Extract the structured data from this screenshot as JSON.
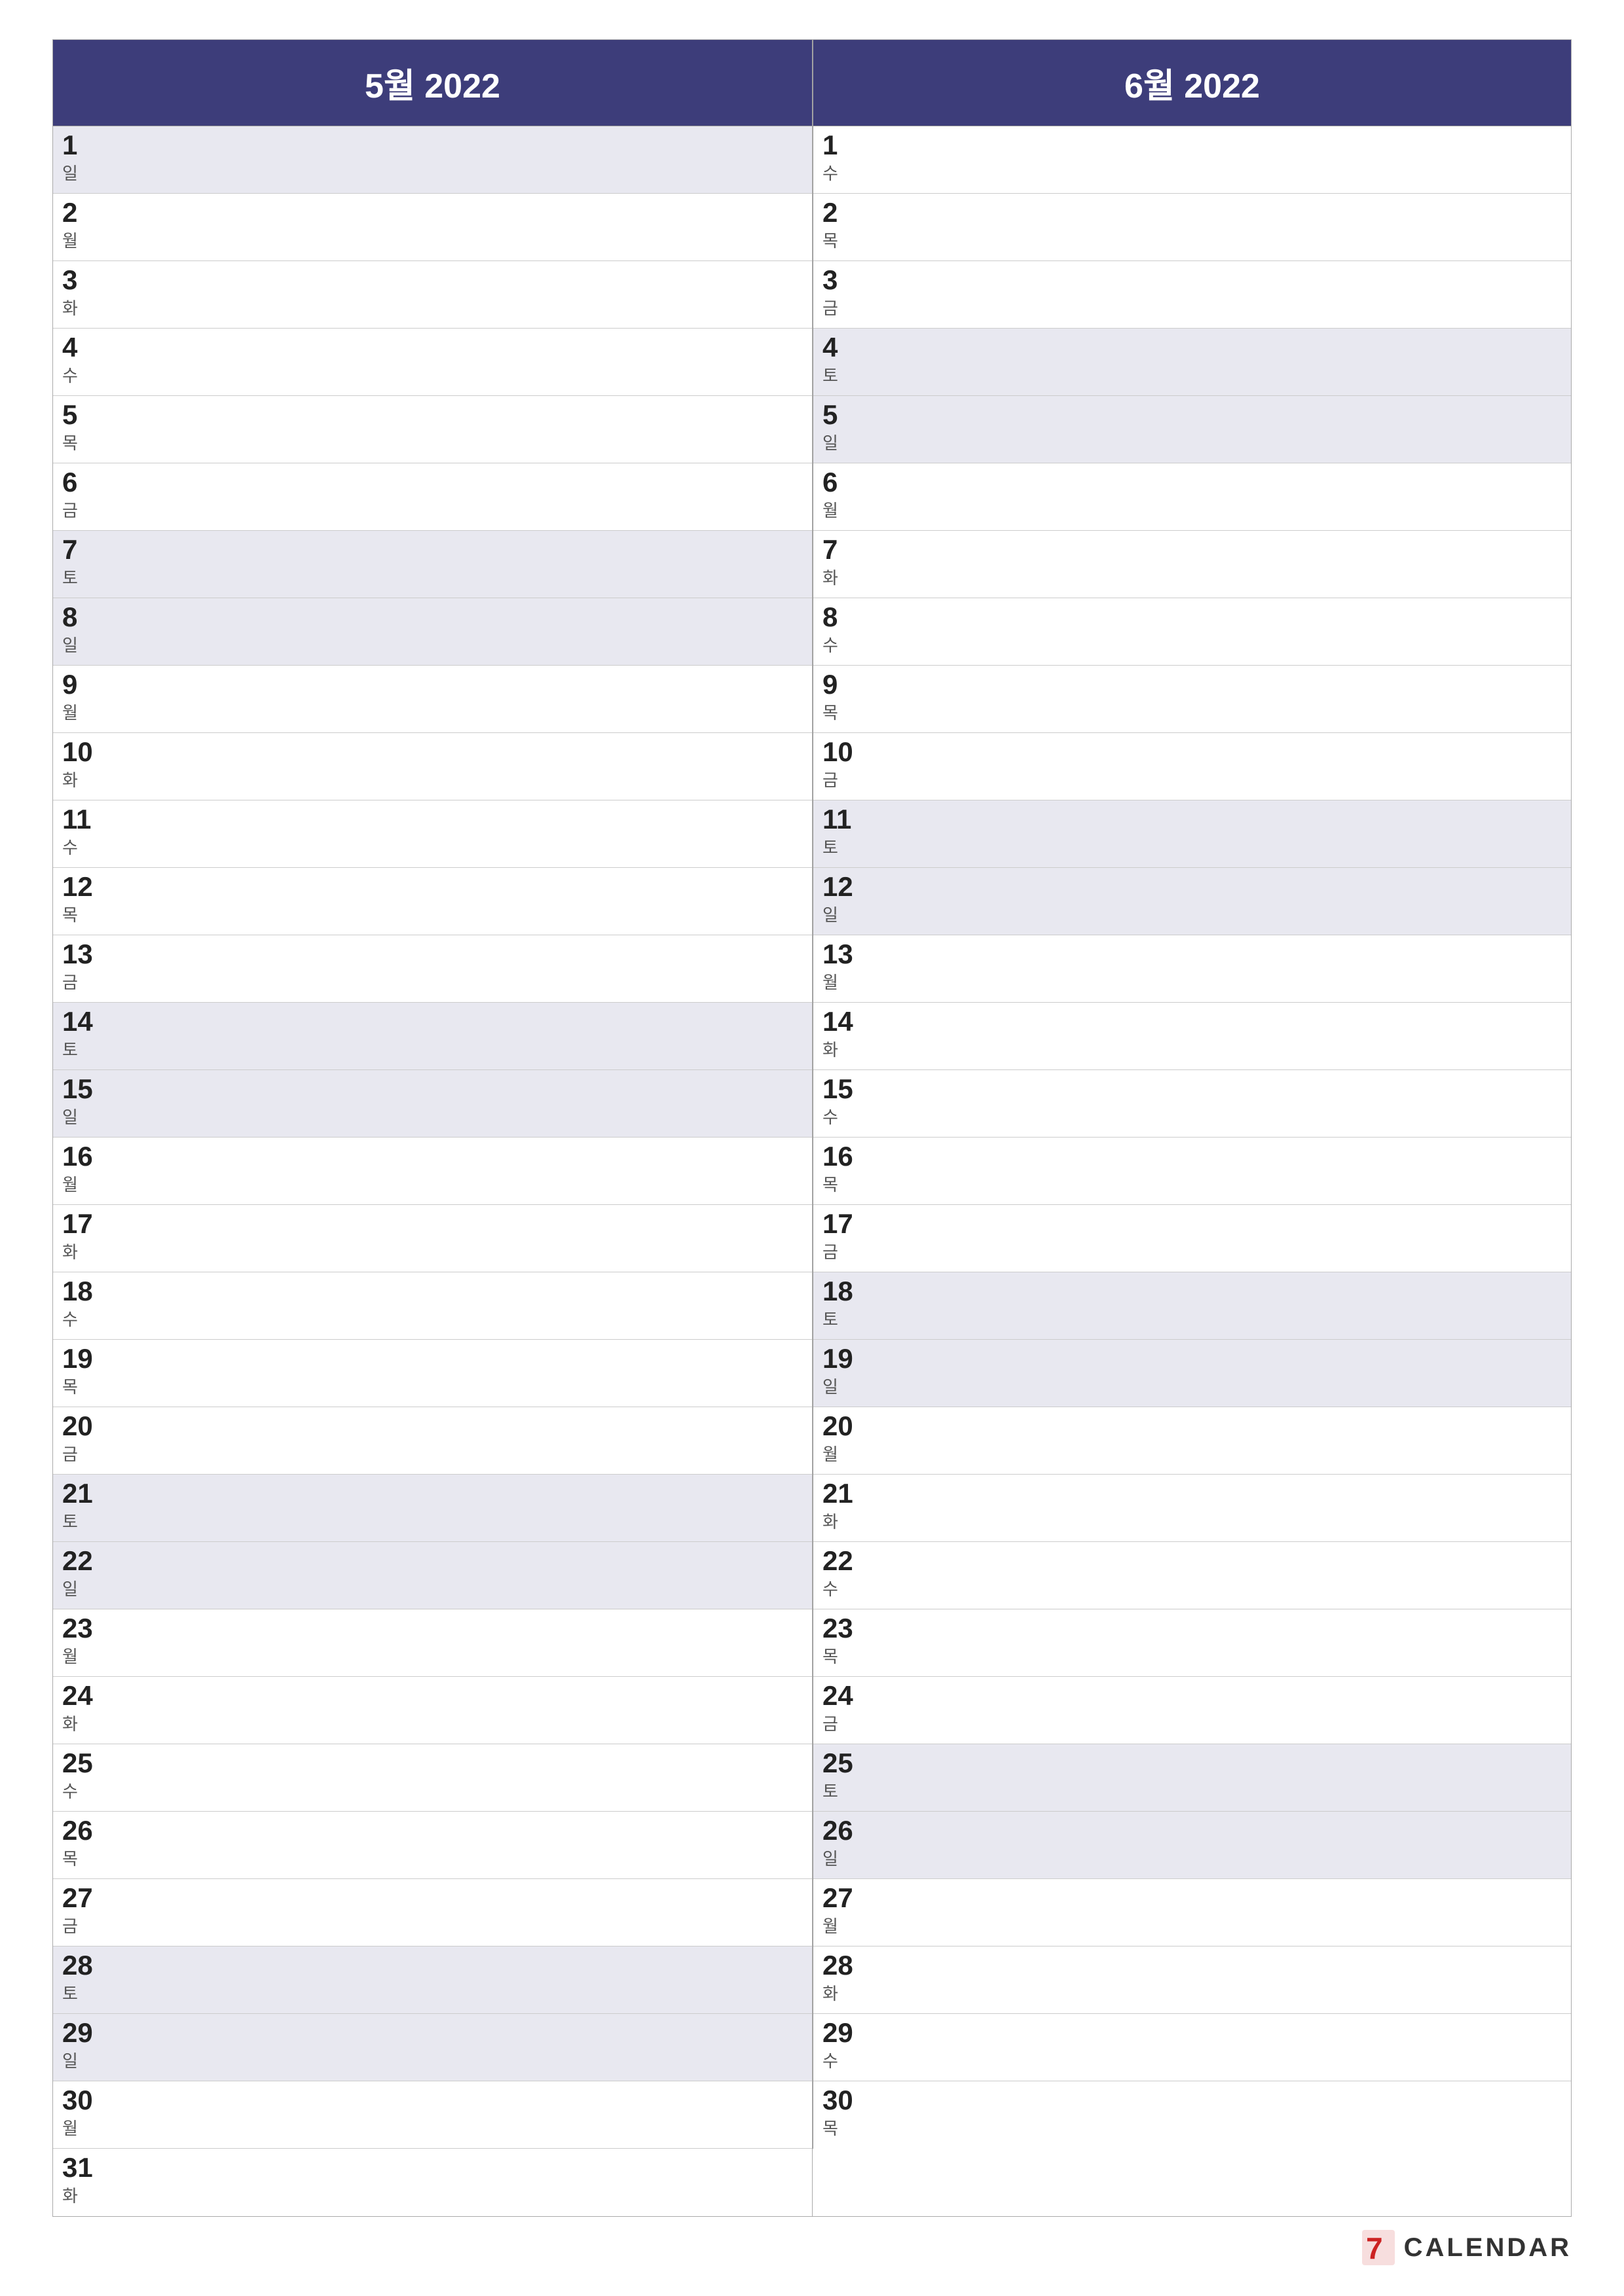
{
  "months": [
    {
      "title": "5월 2022",
      "days": [
        {
          "num": "1",
          "name": "일",
          "weekend": true
        },
        {
          "num": "2",
          "name": "월",
          "weekend": false
        },
        {
          "num": "3",
          "name": "화",
          "weekend": false
        },
        {
          "num": "4",
          "name": "수",
          "weekend": false
        },
        {
          "num": "5",
          "name": "목",
          "weekend": false
        },
        {
          "num": "6",
          "name": "금",
          "weekend": false
        },
        {
          "num": "7",
          "name": "토",
          "weekend": true
        },
        {
          "num": "8",
          "name": "일",
          "weekend": true
        },
        {
          "num": "9",
          "name": "월",
          "weekend": false
        },
        {
          "num": "10",
          "name": "화",
          "weekend": false
        },
        {
          "num": "11",
          "name": "수",
          "weekend": false
        },
        {
          "num": "12",
          "name": "목",
          "weekend": false
        },
        {
          "num": "13",
          "name": "금",
          "weekend": false
        },
        {
          "num": "14",
          "name": "토",
          "weekend": true
        },
        {
          "num": "15",
          "name": "일",
          "weekend": true
        },
        {
          "num": "16",
          "name": "월",
          "weekend": false
        },
        {
          "num": "17",
          "name": "화",
          "weekend": false
        },
        {
          "num": "18",
          "name": "수",
          "weekend": false
        },
        {
          "num": "19",
          "name": "목",
          "weekend": false
        },
        {
          "num": "20",
          "name": "금",
          "weekend": false
        },
        {
          "num": "21",
          "name": "토",
          "weekend": true
        },
        {
          "num": "22",
          "name": "일",
          "weekend": true
        },
        {
          "num": "23",
          "name": "월",
          "weekend": false
        },
        {
          "num": "24",
          "name": "화",
          "weekend": false
        },
        {
          "num": "25",
          "name": "수",
          "weekend": false
        },
        {
          "num": "26",
          "name": "목",
          "weekend": false
        },
        {
          "num": "27",
          "name": "금",
          "weekend": false
        },
        {
          "num": "28",
          "name": "토",
          "weekend": true
        },
        {
          "num": "29",
          "name": "일",
          "weekend": true
        },
        {
          "num": "30",
          "name": "월",
          "weekend": false
        },
        {
          "num": "31",
          "name": "화",
          "weekend": false
        }
      ]
    },
    {
      "title": "6월 2022",
      "days": [
        {
          "num": "1",
          "name": "수",
          "weekend": false
        },
        {
          "num": "2",
          "name": "목",
          "weekend": false
        },
        {
          "num": "3",
          "name": "금",
          "weekend": false
        },
        {
          "num": "4",
          "name": "토",
          "weekend": true
        },
        {
          "num": "5",
          "name": "일",
          "weekend": true
        },
        {
          "num": "6",
          "name": "월",
          "weekend": false
        },
        {
          "num": "7",
          "name": "화",
          "weekend": false
        },
        {
          "num": "8",
          "name": "수",
          "weekend": false
        },
        {
          "num": "9",
          "name": "목",
          "weekend": false
        },
        {
          "num": "10",
          "name": "금",
          "weekend": false
        },
        {
          "num": "11",
          "name": "토",
          "weekend": true
        },
        {
          "num": "12",
          "name": "일",
          "weekend": true
        },
        {
          "num": "13",
          "name": "월",
          "weekend": false
        },
        {
          "num": "14",
          "name": "화",
          "weekend": false
        },
        {
          "num": "15",
          "name": "수",
          "weekend": false
        },
        {
          "num": "16",
          "name": "목",
          "weekend": false
        },
        {
          "num": "17",
          "name": "금",
          "weekend": false
        },
        {
          "num": "18",
          "name": "토",
          "weekend": true
        },
        {
          "num": "19",
          "name": "일",
          "weekend": true
        },
        {
          "num": "20",
          "name": "월",
          "weekend": false
        },
        {
          "num": "21",
          "name": "화",
          "weekend": false
        },
        {
          "num": "22",
          "name": "수",
          "weekend": false
        },
        {
          "num": "23",
          "name": "목",
          "weekend": false
        },
        {
          "num": "24",
          "name": "금",
          "weekend": false
        },
        {
          "num": "25",
          "name": "토",
          "weekend": true
        },
        {
          "num": "26",
          "name": "일",
          "weekend": true
        },
        {
          "num": "27",
          "name": "월",
          "weekend": false
        },
        {
          "num": "28",
          "name": "화",
          "weekend": false
        },
        {
          "num": "29",
          "name": "수",
          "weekend": false
        },
        {
          "num": "30",
          "name": "목",
          "weekend": false
        }
      ]
    }
  ],
  "brand": {
    "label": "CALENDAR",
    "icon_color": "#cc2222"
  }
}
